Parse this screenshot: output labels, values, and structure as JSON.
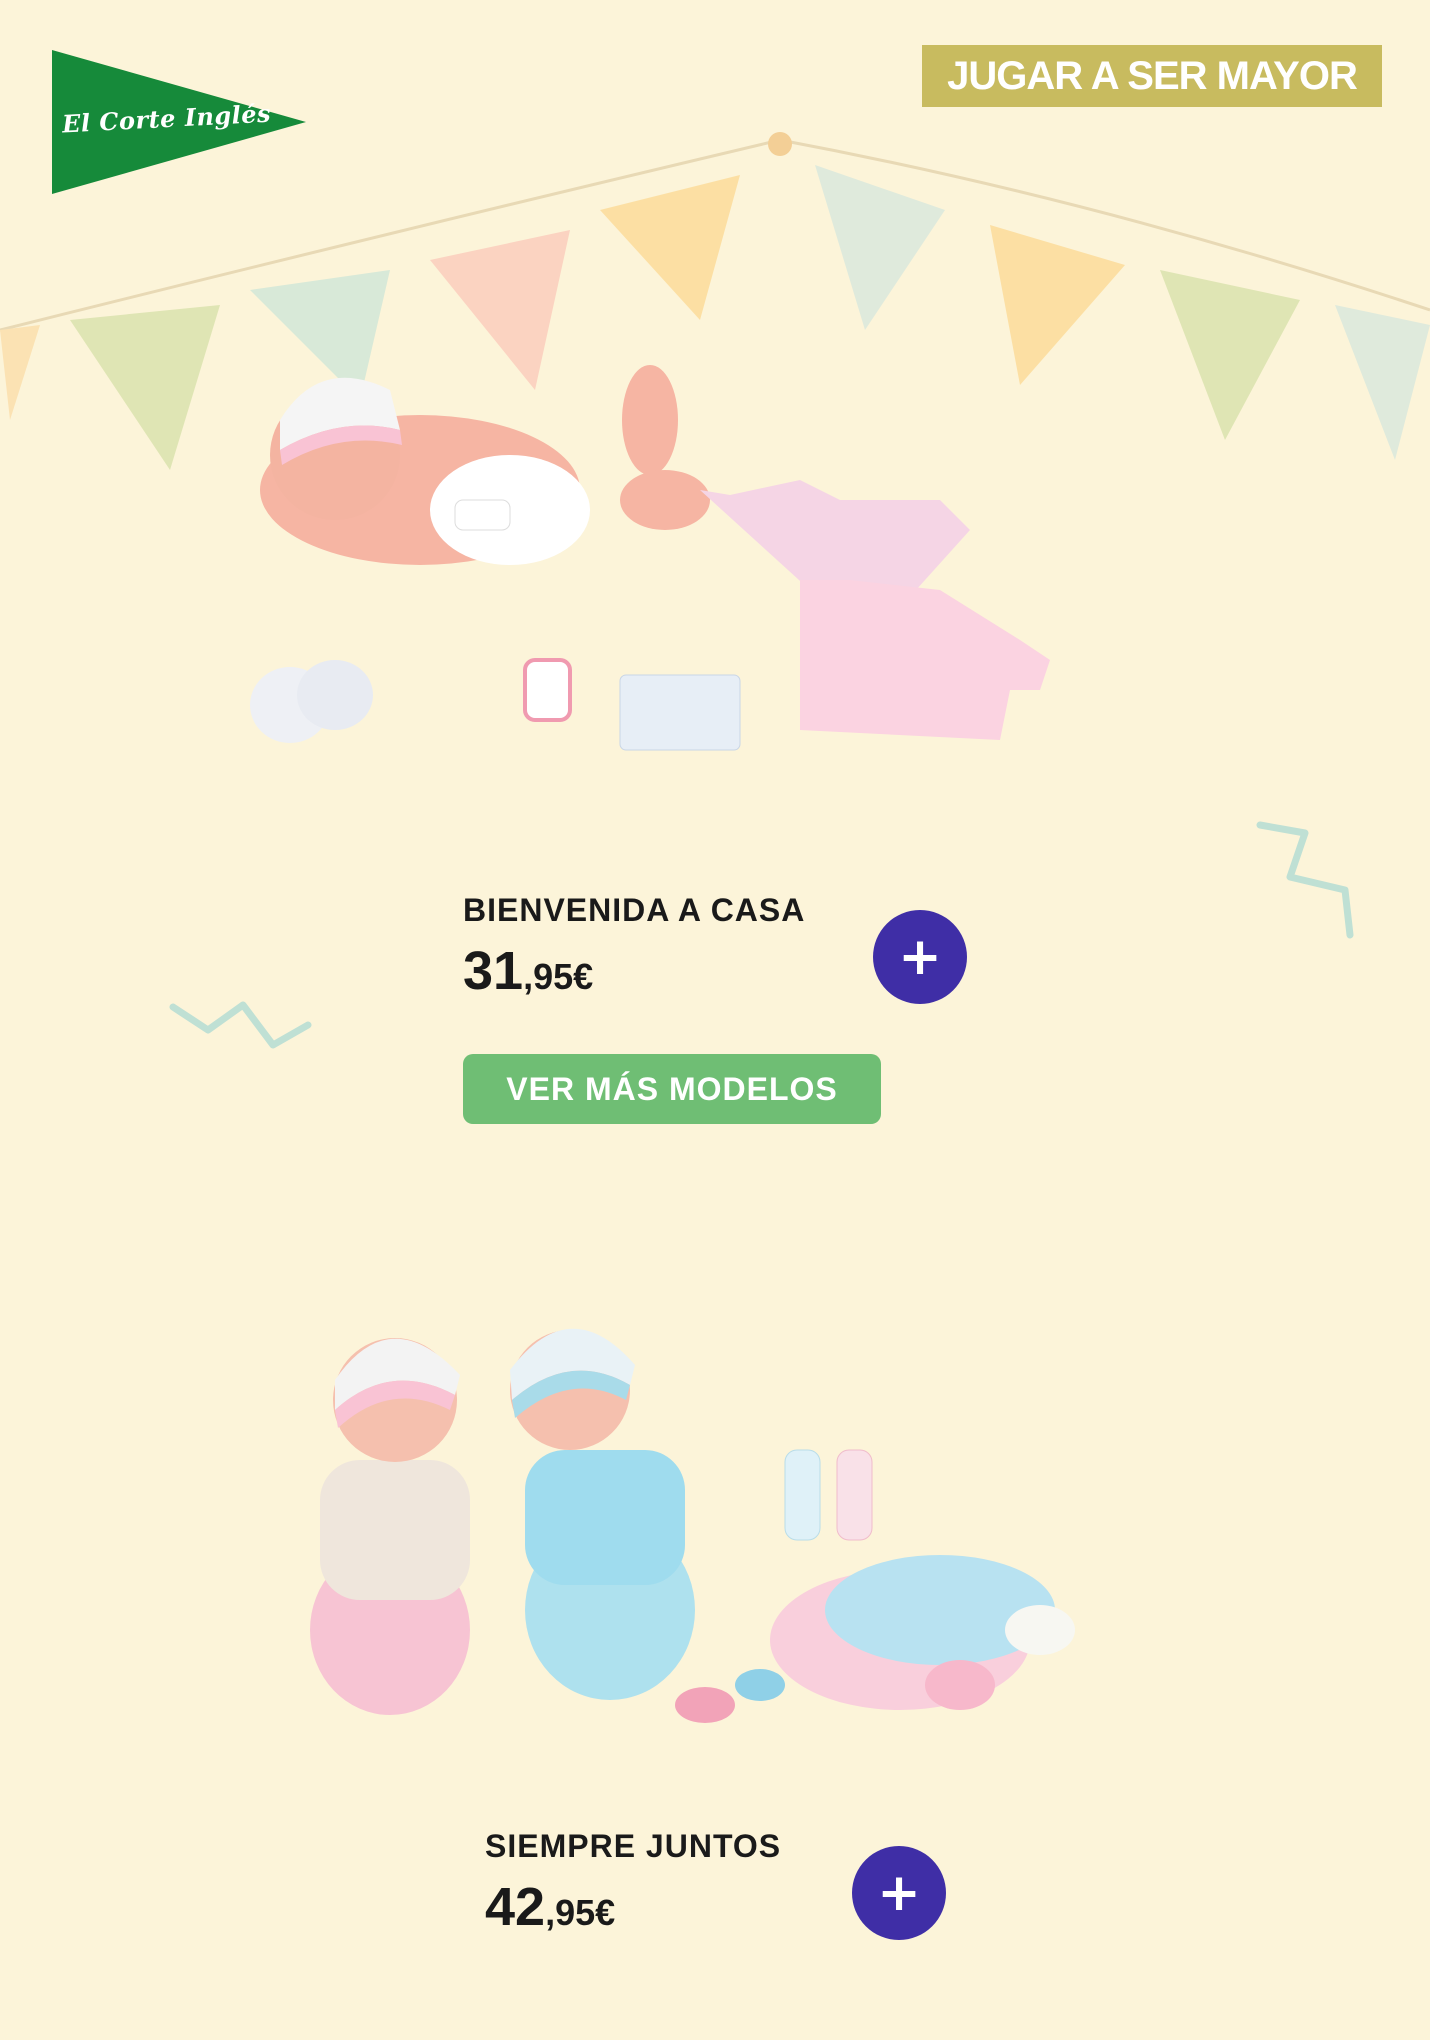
{
  "brand": {
    "name": "El Corte Inglés",
    "logo_color": "#168a3a"
  },
  "header": {
    "category": "JUGAR A SER MAYOR",
    "category_bg": "#c8bb5f"
  },
  "products": [
    {
      "name": "BIENVENIDA A CASA",
      "price_int": "31",
      "price_dec": ",95€",
      "add_label": "+",
      "image_icon": "newborn-doll-set-image"
    },
    {
      "name": "SIEMPRE JUNTOS",
      "price_int": "42",
      "price_dec": ",95€",
      "add_label": "+",
      "image_icon": "twin-dolls-set-image"
    }
  ],
  "more_models": {
    "label": "VER MÁS MODELOS",
    "color": "#6fbe74"
  },
  "colors": {
    "background": "#fcf4d9",
    "accent_button": "#3f2ea6"
  }
}
